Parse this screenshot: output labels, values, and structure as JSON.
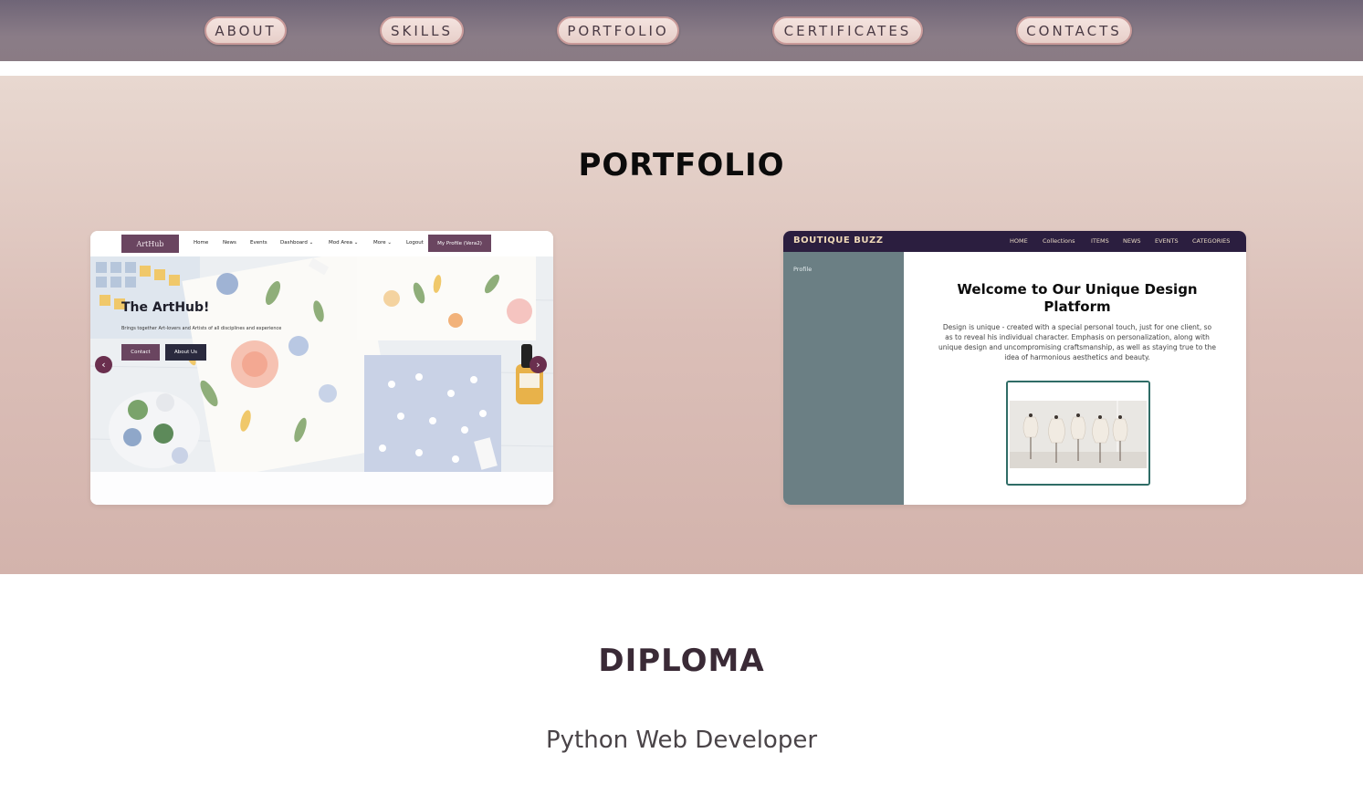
{
  "nav": {
    "items": [
      {
        "label": "ABOUT"
      },
      {
        "label": "SKILLS"
      },
      {
        "label": "PORTFOLIO"
      },
      {
        "label": "CERTIFICATES"
      },
      {
        "label": "CONTACTS"
      }
    ]
  },
  "portfolio": {
    "title": "PORTFOLIO",
    "projects": [
      {
        "logo": "ArtHub",
        "nav_links": [
          "Home",
          "News",
          "Events",
          "Dashboard ⌄",
          "Mod Area ⌄",
          "More ⌄",
          "Logout"
        ],
        "profile_button": "My Profile (Vera2)",
        "hero_title": "The ArtHub!",
        "hero_subtitle": "Brings together Art-lovers and Artists of all disciplines and experience",
        "contact_button": "Contact",
        "about_button": "About Us",
        "prev_arrow": "‹",
        "next_arrow": "›"
      },
      {
        "brand": "BOUTIQUE BUZZ",
        "nav_links": [
          "HOME",
          "Collections",
          "ITEMS",
          "NEWS",
          "EVENTS",
          "CATEGORIES"
        ],
        "sidebar_label": "Profile",
        "title": "Welcome to Our Unique Design Platform",
        "text": "Design is unique - created with a special personal touch, just for one client, so as to reveal his individual character. Emphasis on personalization, along with unique design and uncompromising craftsmanship, as well as staying true to the idea of harmonious aesthetics and beauty."
      }
    ]
  },
  "diploma": {
    "title": "DIPLOMA",
    "subtitle": "Python Web Developer"
  },
  "colors": {
    "nav_bg": "#7d7080",
    "button_fill": "#f0ddd8",
    "button_border": "#c99a99",
    "section_bg_top": "#e8d8d0",
    "section_bg_bottom": "#d3b3ac",
    "arthub_accent": "#6a4560",
    "boutique_nav": "#2b1e3f",
    "boutique_sidebar": "#6b7f84"
  }
}
